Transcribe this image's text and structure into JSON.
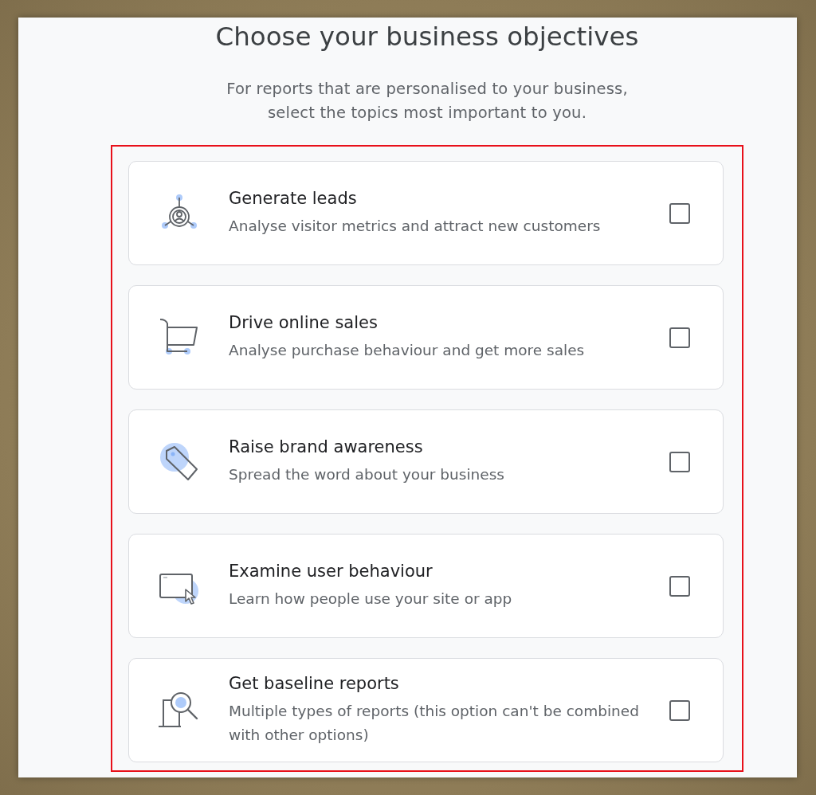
{
  "title": "Choose your business objectives",
  "subtitle": "For reports that are personalised to your business,\nselect the topics most important to you.",
  "objectives": [
    {
      "kind": "leads",
      "title": "Generate leads",
      "description": "Analyse visitor metrics and attract new customers",
      "checked": false
    },
    {
      "kind": "sales",
      "title": "Drive online sales",
      "description": "Analyse purchase behaviour and get more sales",
      "checked": false
    },
    {
      "kind": "awareness",
      "title": "Raise brand awareness",
      "description": "Spread the word about your business",
      "checked": false
    },
    {
      "kind": "behaviour",
      "title": "Examine user behaviour",
      "description": "Learn how people use your site or app",
      "checked": false
    },
    {
      "kind": "baseline",
      "title": "Get baseline reports",
      "description": "Multiple types of reports (this option can't be combined with other options)",
      "checked": false
    }
  ]
}
